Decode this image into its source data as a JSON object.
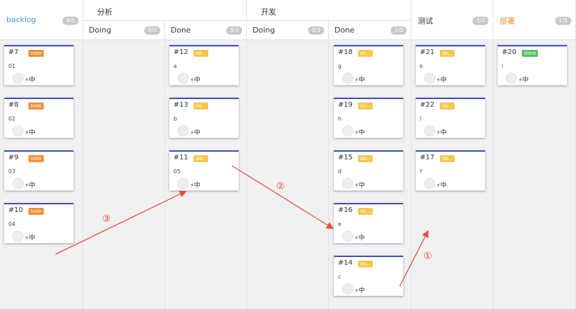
{
  "columns": {
    "backlog": {
      "title": "backlog",
      "count": "4/5"
    },
    "analysis": {
      "group": "分析",
      "doing": {
        "title": "Doing",
        "count": "0/2"
      },
      "done": {
        "title": "Done",
        "count": "3/3"
      }
    },
    "dev": {
      "group": "开发",
      "doing": {
        "title": "Doing",
        "count": "0/3"
      },
      "done": {
        "title": "Done",
        "count": "5/5"
      }
    },
    "test": {
      "title": "测试",
      "count": "3/3"
    },
    "deploy": {
      "title": "部署",
      "count": "1/5"
    }
  },
  "cards": [
    {
      "id": "#7",
      "tag": "todo",
      "desc": "01",
      "priority": "中"
    },
    {
      "id": "#8",
      "tag": "todo",
      "desc": "02",
      "priority": "中"
    },
    {
      "id": "#9",
      "tag": "todo",
      "desc": "03",
      "priority": "中"
    },
    {
      "id": "#10",
      "tag": "todo",
      "desc": "04",
      "priority": "中"
    },
    {
      "id": "#12",
      "tag": "do...",
      "desc": "a",
      "priority": "中"
    },
    {
      "id": "#13",
      "tag": "do...",
      "desc": "b",
      "priority": "中"
    },
    {
      "id": "#11",
      "tag": "do...",
      "desc": "05",
      "priority": "中"
    },
    {
      "id": "#18",
      "tag": "do...",
      "desc": "g",
      "priority": "中"
    },
    {
      "id": "#19",
      "tag": "do...",
      "desc": "h",
      "priority": "中"
    },
    {
      "id": "#15",
      "tag": "do...",
      "desc": "d",
      "priority": "中"
    },
    {
      "id": "#16",
      "tag": "do...",
      "desc": "e",
      "priority": "中"
    },
    {
      "id": "#14",
      "tag": "do...",
      "desc": "c",
      "priority": "中"
    },
    {
      "id": "#21",
      "tag": "do...",
      "desc": "k",
      "priority": "中"
    },
    {
      "id": "#22",
      "tag": "do...",
      "desc": "l",
      "priority": "中"
    },
    {
      "id": "#17",
      "tag": "do...",
      "desc": "f",
      "priority": "中"
    },
    {
      "id": "#20",
      "tag": "done",
      "desc": "i",
      "priority": "中"
    }
  ],
  "annotations": {
    "one": "①",
    "two": "②",
    "three": "③"
  },
  "colors": {
    "card_border": "#3f51b5",
    "todo": "#ef8f32",
    "doing": "#f4c64b",
    "done": "#56be5b",
    "backlog_title": "#4a90e2",
    "deploy_title": "#f08a3a",
    "arrow": "#e84c3d"
  }
}
